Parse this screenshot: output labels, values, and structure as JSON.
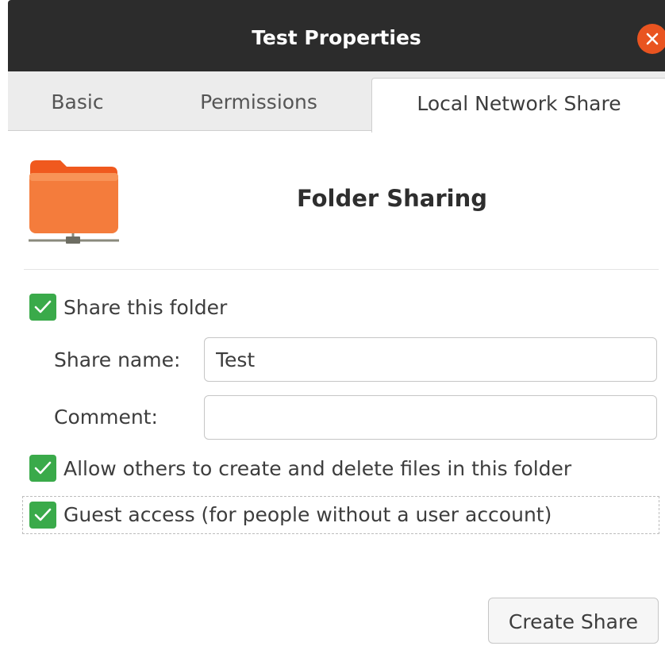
{
  "window": {
    "title": "Test Properties",
    "close_icon": "close-icon"
  },
  "tabs": [
    {
      "label": "Basic",
      "active": false
    },
    {
      "label": "Permissions",
      "active": false
    },
    {
      "label": "Local Network Share",
      "active": true
    }
  ],
  "header": {
    "icon": "folder-share-icon",
    "title": "Folder Sharing"
  },
  "share": {
    "share_folder_label": "Share this folder",
    "share_folder_checked": true,
    "share_name_label": "Share name:",
    "share_name_value": "Test",
    "comment_label": "Comment:",
    "comment_value": "",
    "allow_write_label": "Allow others to create and delete files in this folder",
    "allow_write_checked": true,
    "guest_label": "Guest access (for people without a user account)",
    "guest_checked": true
  },
  "actions": {
    "create_label": "Create Share"
  },
  "colors": {
    "titlebar": "#2c2c2c",
    "close_button": "#e95420",
    "checkbox": "#3aaa4a",
    "folder_orange": "#f47c3c"
  }
}
